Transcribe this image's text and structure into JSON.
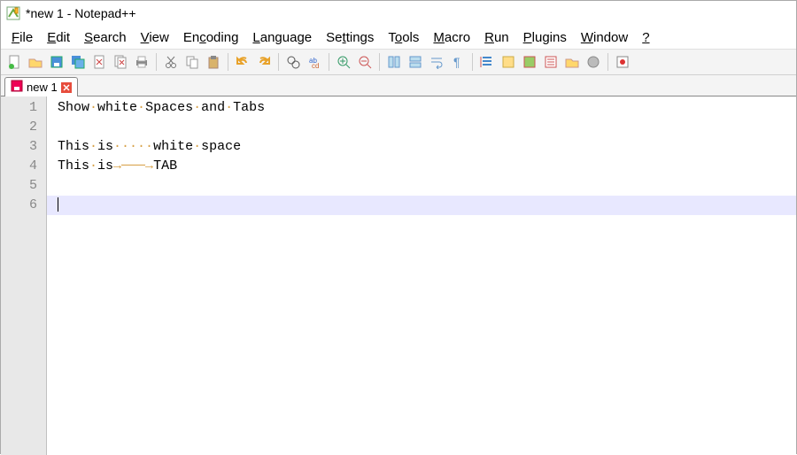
{
  "title": "*new 1 - Notepad++",
  "menus": [
    "File",
    "Edit",
    "Search",
    "View",
    "Encoding",
    "Language",
    "Settings",
    "Tools",
    "Macro",
    "Run",
    "Plugins",
    "Window",
    "?"
  ],
  "tab": {
    "label": "new 1"
  },
  "lines": {
    "l1_w1": "Show",
    "l1_w2": "white",
    "l1_w3": "Spaces",
    "l1_w4": "and",
    "l1_w5": "Tabs",
    "l3_w1": "This",
    "l3_w2": "is",
    "l3_w3": "white",
    "l3_w4": "space",
    "l4_w1": "This",
    "l4_w2": "is",
    "l4_w3": "TAB"
  },
  "line_numbers": [
    "1",
    "2",
    "3",
    "4",
    "5",
    "6"
  ]
}
